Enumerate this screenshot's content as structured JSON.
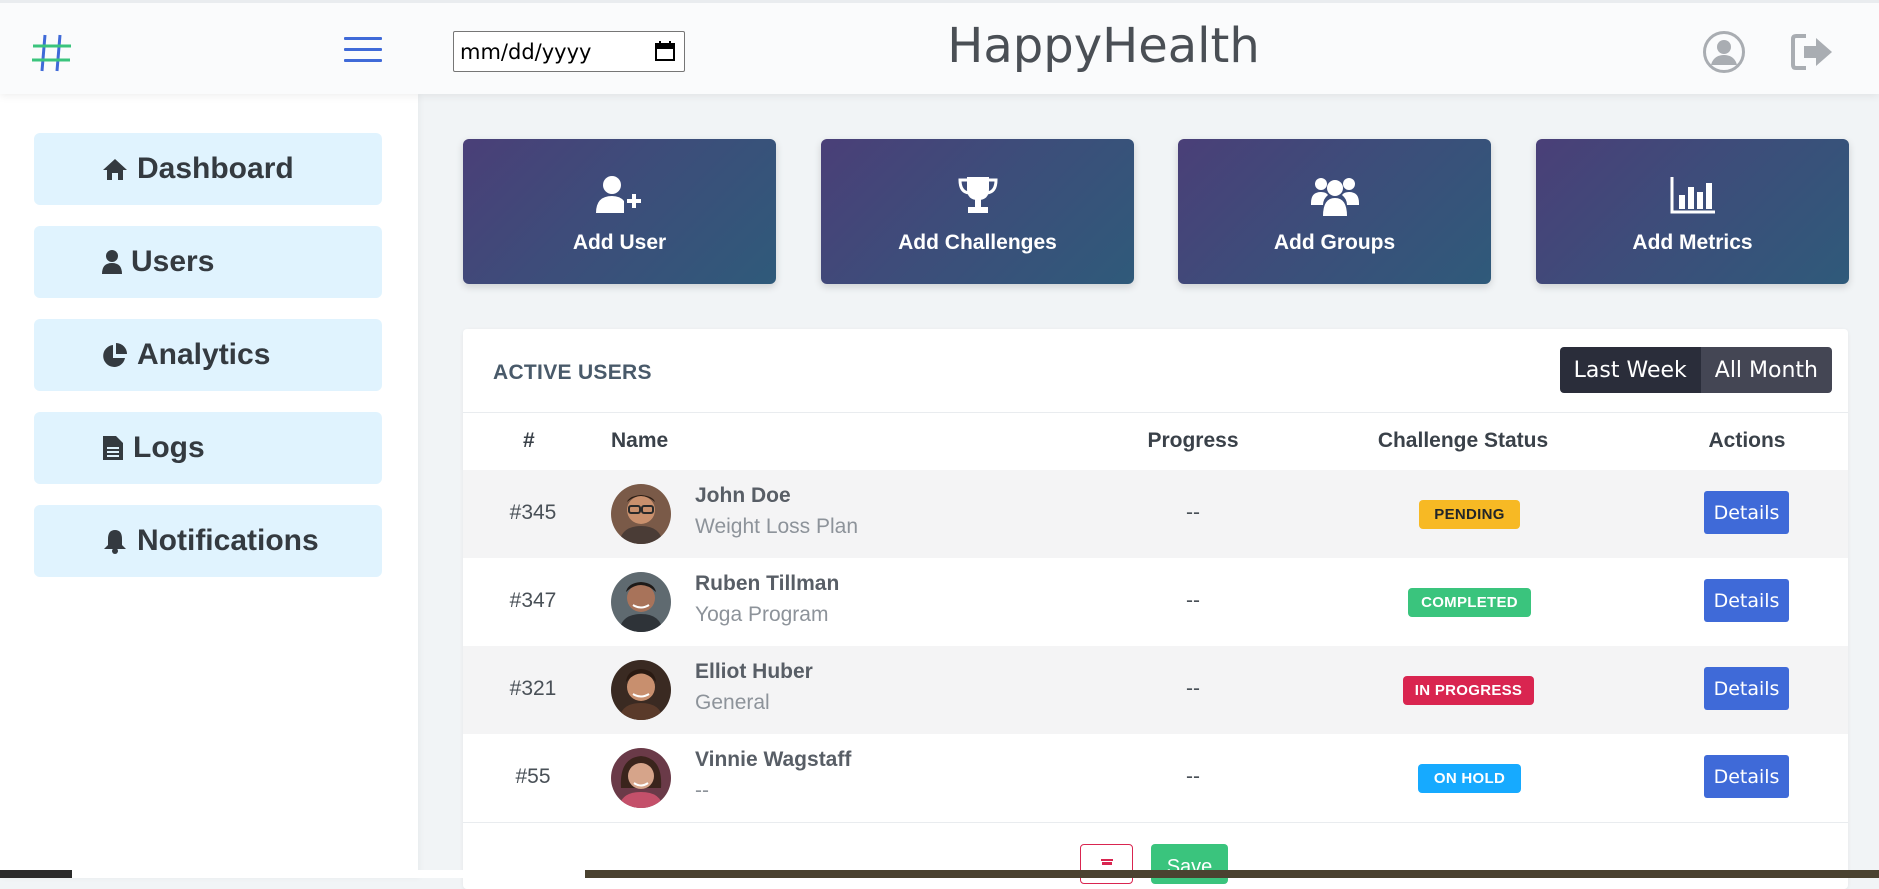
{
  "header": {
    "brand": "HappyHealth",
    "date_placeholder": "mm/dd/yyyy",
    "accent": "#3f6ad8"
  },
  "sidebar": {
    "items": [
      {
        "label": "Dashboard",
        "icon": "home-icon"
      },
      {
        "label": "Users",
        "icon": "user-icon"
      },
      {
        "label": "Analytics",
        "icon": "pie-chart-icon"
      },
      {
        "label": "Logs",
        "icon": "file-icon"
      },
      {
        "label": "Notifications",
        "icon": "bell-icon"
      }
    ]
  },
  "cards": [
    {
      "label": "Add User",
      "icon": "add-user-icon"
    },
    {
      "label": "Add Challenges",
      "icon": "trophy-icon"
    },
    {
      "label": "Add Groups",
      "icon": "users-icon"
    },
    {
      "label": "Add Metrics",
      "icon": "bar-chart-icon"
    }
  ],
  "panel": {
    "title": "ACTIVE USERS",
    "filters": [
      "Last Week",
      "All Month"
    ],
    "columns": [
      "#",
      "Name",
      "Progress",
      "Challenge Status",
      "Actions"
    ],
    "rows": [
      {
        "id": "#345",
        "name": "John Doe",
        "plan": "Weight Loss Plan",
        "progress": "--",
        "status": "PENDING",
        "status_color": "#f7b924",
        "status_text_color": "#212529",
        "action": "Details"
      },
      {
        "id": "#347",
        "name": "Ruben Tillman",
        "plan": "Yoga Program",
        "progress": "--",
        "status": "COMPLETED",
        "status_color": "#3ac47d",
        "status_text_color": "#ffffff",
        "action": "Details"
      },
      {
        "id": "#321",
        "name": "Elliot Huber",
        "plan": "General",
        "progress": "--",
        "status": "IN PROGRESS",
        "status_color": "#d92550",
        "status_text_color": "#ffffff",
        "action": "Details"
      },
      {
        "id": "#55",
        "name": "Vinnie Wagstaff",
        "plan": "--",
        "progress": "--",
        "status": "ON HOLD",
        "status_color": "#16aaff",
        "status_text_color": "#ffffff",
        "action": "Details"
      }
    ],
    "save_label": "Save"
  }
}
